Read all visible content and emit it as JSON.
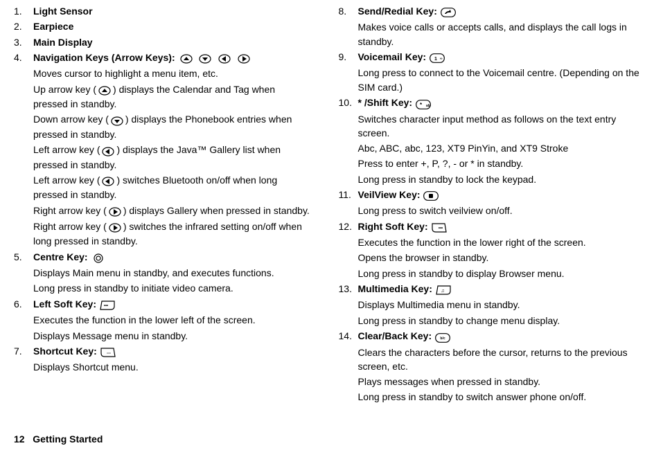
{
  "footer": {
    "prefix": "12",
    "section": "Getting Started"
  },
  "iconGlyphs": {
    "up": "▲",
    "down": "▼",
    "left": "◀",
    "right": "▶"
  },
  "col1": [
    {
      "num": "1.",
      "title": "Light Sensor",
      "icons": [],
      "desc": []
    },
    {
      "num": "2.",
      "title": "Earpiece",
      "icons": [],
      "desc": []
    },
    {
      "num": "3.",
      "title": "Main Display",
      "icons": [],
      "desc": []
    },
    {
      "num": "4.",
      "title": "Navigation Keys (Arrow Keys):",
      "icons": [
        "nav-up",
        "nav-down",
        "nav-left",
        "nav-right"
      ],
      "desc": [
        {
          "type": "text",
          "text": "Moves cursor to highlight a menu item, etc."
        },
        {
          "type": "mixed",
          "parts": [
            {
              "t": "Up arrow key ("
            },
            {
              "icon": "nav-up"
            },
            {
              "t": ") displays the Calendar and Tag when pressed in standby."
            }
          ]
        },
        {
          "type": "mixed",
          "parts": [
            {
              "t": "Down arrow key ("
            },
            {
              "icon": "nav-down"
            },
            {
              "t": ") displays the Phonebook entries when pressed in standby."
            }
          ]
        },
        {
          "type": "mixed",
          "parts": [
            {
              "t": "Left arrow key ("
            },
            {
              "icon": "nav-left"
            },
            {
              "t": ") displays the Java™ Gallery list when pressed in standby."
            }
          ]
        },
        {
          "type": "mixed",
          "parts": [
            {
              "t": "Left arrow key ("
            },
            {
              "icon": "nav-left"
            },
            {
              "t": ") switches Bluetooth on/off when long pressed in standby."
            }
          ]
        },
        {
          "type": "mixed",
          "parts": [
            {
              "t": "Right arrow key ("
            },
            {
              "icon": "nav-right"
            },
            {
              "t": ") displays Gallery when pressed in standby."
            }
          ]
        },
        {
          "type": "mixed",
          "parts": [
            {
              "t": "Right arrow key ("
            },
            {
              "icon": "nav-right"
            },
            {
              "t": ") switches the infrared setting on/off when long pressed in standby."
            }
          ]
        }
      ]
    },
    {
      "num": "5.",
      "title": "Centre Key:",
      "icons": [
        "centre-key"
      ],
      "desc": [
        {
          "type": "text",
          "text": "Displays Main menu in standby, and executes functions."
        },
        {
          "type": "text",
          "text": "Long press in standby to initiate video camera."
        }
      ]
    },
    {
      "num": "6.",
      "title": "Left Soft Key:",
      "icons": [
        "left-soft-key"
      ],
      "desc": [
        {
          "type": "text",
          "text": "Executes the function in the lower left of the screen."
        },
        {
          "type": "text",
          "text": "Displays Message menu in standby."
        }
      ]
    },
    {
      "num": "7.",
      "title": "Shortcut Key:",
      "icons": [
        "shortcut-key"
      ],
      "desc": [
        {
          "type": "text",
          "text": "Displays Shortcut menu."
        }
      ]
    }
  ],
  "col2": [
    {
      "num": "8.",
      "title": "Send/Redial Key:",
      "icons": [
        "send-key"
      ],
      "desc": [
        {
          "type": "text",
          "text": "Makes voice calls or accepts calls, and displays the call logs in standby."
        }
      ]
    },
    {
      "num": "9.",
      "title": "Voicemail Key:",
      "icons": [
        "voicemail-key"
      ],
      "desc": [
        {
          "type": "text",
          "text": "Long press to connect to the Voicemail centre. (Depending on the SIM card.)"
        }
      ]
    },
    {
      "num": "10.",
      "title": "* /Shift Key:",
      "icons": [
        "shift-key"
      ],
      "desc": [
        {
          "type": "text",
          "text": "Switches character input method as follows on the text entry screen."
        },
        {
          "type": "text",
          "text": "Abc, ABC, abc, 123, XT9 PinYin, and XT9 Stroke"
        },
        {
          "type": "text",
          "text": "Press to enter +, P, ?, - or * in standby."
        },
        {
          "type": "text",
          "text": "Long press in standby to lock the keypad."
        }
      ]
    },
    {
      "num": "11.",
      "title": "VeilView Key:",
      "icons": [
        "veilview-key"
      ],
      "desc": [
        {
          "type": "text",
          "text": "Long press to switch veilview on/off."
        }
      ]
    },
    {
      "num": "12.",
      "title": "Right Soft Key:",
      "icons": [
        "right-soft-key"
      ],
      "desc": [
        {
          "type": "text",
          "text": "Executes the function in the lower right of the screen."
        },
        {
          "type": "text",
          "text": "Opens the browser in standby."
        },
        {
          "type": "text",
          "text": "Long press in standby to display Browser menu."
        }
      ]
    },
    {
      "num": "13.",
      "title": "Multimedia Key:",
      "icons": [
        "multimedia-key"
      ],
      "desc": [
        {
          "type": "text",
          "text": "Displays Multimedia menu in standby."
        },
        {
          "type": "text",
          "text": "Long press in standby to change menu display."
        }
      ]
    },
    {
      "num": "14.",
      "title": "Clear/Back Key:",
      "icons": [
        "clear-key"
      ],
      "desc": [
        {
          "type": "text",
          "text": "Clears the characters before the cursor, returns to the previous screen, etc."
        },
        {
          "type": "text",
          "text": "Plays messages when pressed in standby."
        },
        {
          "type": "text",
          "text": "Long press in standby to switch answer phone on/off."
        }
      ]
    }
  ]
}
